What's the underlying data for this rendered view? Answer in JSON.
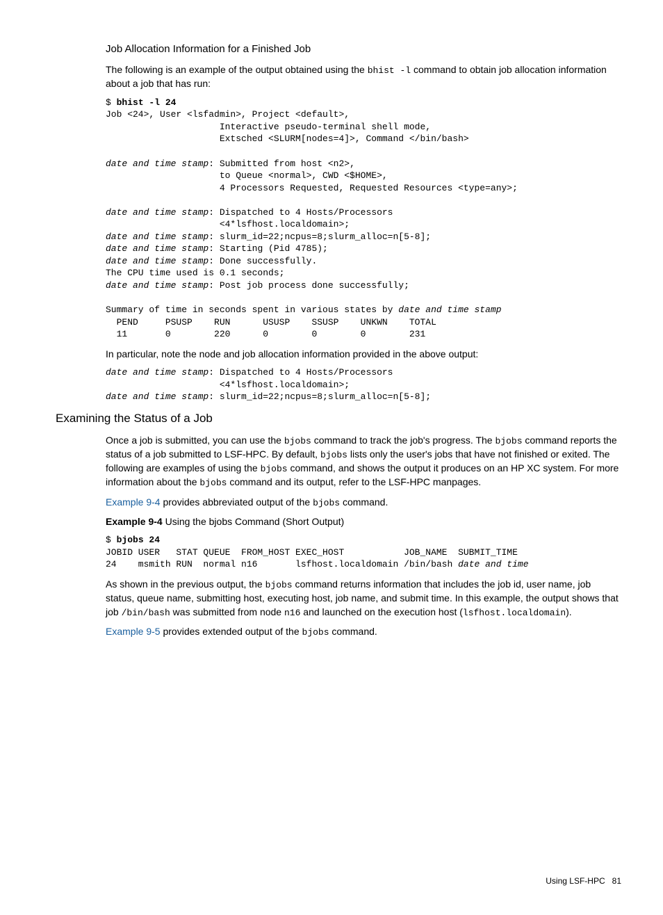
{
  "sec1": {
    "title": "Job Allocation Information for a Finished Job",
    "intro1": "The following is an example of the output obtained using the ",
    "intro_cmd": "bhist -l",
    "intro2": " command to obtain job allocation information about a job that has run:",
    "code": "$ bhist -l 24\nJob <24>, User <lsfadmin>, Project <default>,\n                     Interactive pseudo-terminal shell mode,\n                     Extsched <SLURM[nodes=4]>, Command </bin/bash>\n\ndate and time stamp: Submitted from host <n2>,\n                     to Queue <normal>, CWD <$HOME>,\n                     4 Processors Requested, Requested Resources <type=any>;\n\ndate and time stamp: Dispatched to 4 Hosts/Processors\n                     <4*lsfhost.localdomain>;\ndate and time stamp: slurm_id=22;ncpus=8;slurm_alloc=n[5-8];\ndate and time stamp: Starting (Pid 4785);\ndate and time stamp: Done successfully.\nThe CPU time used is 0.1 seconds;\ndate and time stamp: Post job process done successfully;\n\nSummary of time in seconds spent in various states by date and time stamp\n  PEND     PSUSP    RUN      USUSP    SSUSP    UNKWN    TOTAL\n  11       0        220      0        0        0        231",
    "note": "In particular, note the node and job allocation information provided in the above output:",
    "code2": "date and time stamp: Dispatched to 4 Hosts/Processors\n                     <4*lsfhost.localdomain>;\ndate and time stamp: slurm_id=22;ncpus=8;slurm_alloc=n[5-8];"
  },
  "sec2": {
    "title": "Examining the Status of a Job",
    "para1a": "Once a job is submitted, you can use the ",
    "bjobs": "bjobs",
    "para1b": " command to track the job's progress. The ",
    "para1c": " command reports the status of a job submitted to LSF-HPC. By default, ",
    "para1d": " lists only the user's jobs that have not finished or exited. The following are examples of using the ",
    "para1e": " command, and shows the output it produces on an HP XC system. For more information about the ",
    "para1f": " command and its output, refer to the LSF-HPC manpages.",
    "ex94link": "Example 9-4",
    "ex94rest": " provides abbreviated output of the ",
    "ex94rest2": " command.",
    "ex94label": "Example 9-4",
    "ex94caption": "   Using the bjobs Command (Short Output)",
    "ex94code": "$ bjobs 24\nJOBID USER   STAT QUEUE  FROM_HOST EXEC_HOST           JOB_NAME  SUBMIT_TIME\n24    msmith RUN  normal n16       lsfhost.localdomain /bin/bash date and time",
    "para2a": "As shown in the previous output, the ",
    "para2b": " command returns information that includes the job id, user name, job status, queue name, submitting host, executing host, job name, and submit time. In this example, the output shows that job ",
    "binbash": "/bin/bash",
    "para2c": " was submitted from node ",
    "n16": "n16",
    "para2d": " and launched on the execution host (",
    "lsfhost": "lsfhost.localdomain",
    "para2e": ").",
    "ex95link": "Example 9-5",
    "ex95rest": " provides extended output of the ",
    "ex95rest2": " command."
  },
  "footer": {
    "label": "Using LSF-HPC",
    "page": "81"
  }
}
